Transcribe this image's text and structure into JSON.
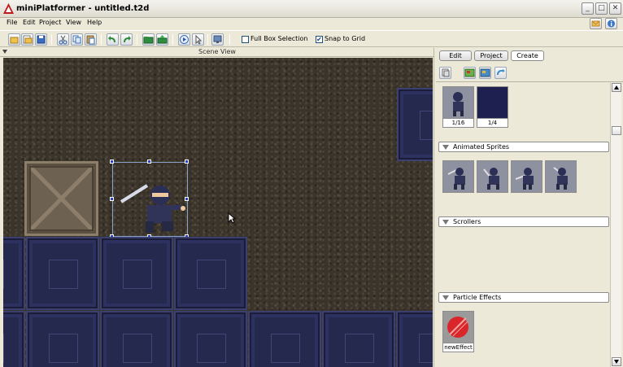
{
  "window": {
    "title": "miniPlatformer - untitled.t2d",
    "buttons": [
      "minimize",
      "maximize",
      "close"
    ]
  },
  "menubar": {
    "items": [
      "File",
      "Edit",
      "Project",
      "View",
      "Help"
    ]
  },
  "toolbar": {
    "full_box_selection_label": "Full Box Selection",
    "full_box_selection_checked": false,
    "snap_to_grid_label": "Snap to Grid",
    "snap_to_grid_checked": true,
    "icons": [
      "new-icon",
      "open-icon",
      "save-icon",
      "cut-icon",
      "copy-icon",
      "paste-icon",
      "undo-icon",
      "redo-icon",
      "folder-add-icon",
      "folder-up-icon",
      "play-icon",
      "select-icon",
      "monitor-icon"
    ]
  },
  "scene": {
    "title": "Scene View"
  },
  "right_panel": {
    "tabs": [
      {
        "label": "Edit",
        "active": false
      },
      {
        "label": "Project",
        "active": false
      },
      {
        "label": "Create",
        "active": true
      }
    ],
    "static_sprites": [
      {
        "caption": "1/16"
      },
      {
        "caption": "1/4"
      }
    ],
    "sections": {
      "animated": "Animated Sprites",
      "scrollers": "Scrollers",
      "particles": "Particle Effects"
    },
    "particle_effects": [
      {
        "caption": "newEffect"
      }
    ]
  },
  "colors": {
    "block": "#25294e",
    "selection_handle": "#2a40c8",
    "background_rock": "#3a342b"
  }
}
